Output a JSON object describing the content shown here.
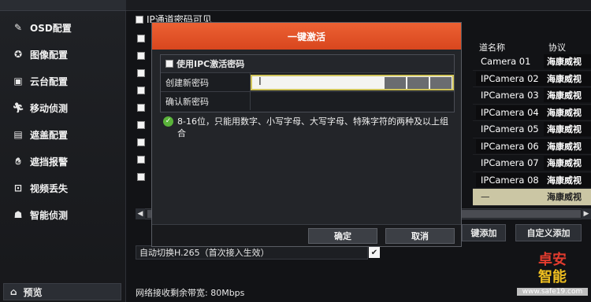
{
  "sidebar": {
    "items": [
      {
        "label": "OSD配置",
        "icon": "osd-icon"
      },
      {
        "label": "图像配置",
        "icon": "image-icon"
      },
      {
        "label": "云台配置",
        "icon": "ptz-icon"
      },
      {
        "label": "移动侦测",
        "icon": "motion-icon"
      },
      {
        "label": "遮盖配置",
        "icon": "mask-icon"
      },
      {
        "label": "遮挡报警",
        "icon": "tamper-icon"
      },
      {
        "label": "视频丢失",
        "icon": "video-loss-icon"
      },
      {
        "label": "智能侦测",
        "icon": "smart-icon"
      }
    ],
    "preview_label": "预览"
  },
  "main": {
    "ip_visible_label": "IP通道密码可见",
    "table": {
      "headers": [
        "道名称",
        "协议"
      ],
      "rows": [
        {
          "name": "Camera 01",
          "protocol": "海康威视"
        },
        {
          "name": "IPCamera 02",
          "protocol": "海康威视"
        },
        {
          "name": "IPCamera 03",
          "protocol": "海康威视"
        },
        {
          "name": "IPCamera 04",
          "protocol": "海康威视"
        },
        {
          "name": "IPCamera 05",
          "protocol": "海康威视"
        },
        {
          "name": "IPCamera 06",
          "protocol": "海康威视"
        },
        {
          "name": "IPCamera 07",
          "protocol": "海康威视"
        },
        {
          "name": "IPCamera 08",
          "protocol": "海康威视"
        },
        {
          "name": "—",
          "protocol": "海康威视"
        }
      ]
    },
    "quick_add_label": "键添加",
    "custom_add_label": "自定义添加",
    "auto_h265_label": "自动切换H.265（首次接入生效）",
    "bandwidth_label": "网络接收剩余带宽: 80Mbps"
  },
  "modal": {
    "title": "一键激活",
    "use_ipc_label": "使用IPC激活密码",
    "new_password_label": "创建新密码",
    "confirm_password_label": "确认新密码",
    "hint": "8-16位，只能用数字、小写字母、大写字母、特殊字符的两种及以上组合",
    "ok_label": "确定",
    "cancel_label": "取消"
  },
  "watermark": {
    "line1": "卓安",
    "line2": "智能",
    "url": "www.safe19.com"
  },
  "colors": {
    "modal_title": "#e4532a",
    "highlight_row": "#cbc6a4",
    "hint_ok": "#5ab33a"
  }
}
